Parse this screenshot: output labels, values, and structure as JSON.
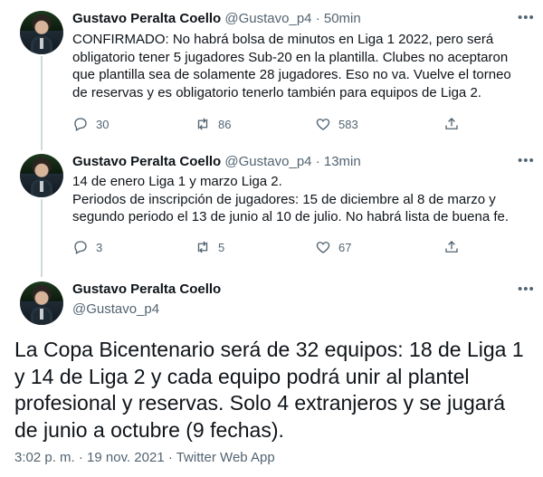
{
  "tweets": [
    {
      "name": "Gustavo Peralta Coello",
      "handle": "@Gustavo_p4",
      "sep": "·",
      "time": "50min",
      "more": "•••",
      "text": "CONFIRMADO: No habrá bolsa de minutos en Liga 1 2022, pero será obligatorio tener 5 jugadores Sub-20 en la plantilla. Clubes no aceptaron que plantilla sea de solamente 28 jugadores. Eso no va. Vuelve el torneo de reservas y es obligatorio tenerlo también para equipos de Liga 2.",
      "replies": "30",
      "retweets": "86",
      "likes": "583"
    },
    {
      "name": "Gustavo Peralta Coello",
      "handle": "@Gustavo_p4",
      "sep": "·",
      "time": "13min",
      "more": "•••",
      "text": "14 de enero Liga 1 y marzo Liga 2.\nPeriodos de inscripción de jugadores: 15 de diciembre al 8 de marzo y segundo periodo el 13 de junio al 10 de julio. No habrá lista de buena fe.",
      "replies": "3",
      "retweets": "5",
      "likes": "67"
    }
  ],
  "main": {
    "name": "Gustavo Peralta Coello",
    "handle": "@Gustavo_p4",
    "more": "•••",
    "text": "La Copa Bicentenario será de 32 equipos: 18 de Liga 1 y 14 de Liga 2 y cada equipo podrá unir al plantel profesional y reservas. Solo 4 extranjeros y se jugará de junio a octubre (9 fechas).",
    "timestamp": "3:02 p. m. · 19 nov. 2021 · Twitter Web App"
  },
  "icons": [
    "reply-icon",
    "retweet-icon",
    "like-icon",
    "share-icon",
    "more-icon"
  ],
  "colors": {
    "text": "#0f1419",
    "muted": "#536471",
    "thread_line": "#cfd9de"
  }
}
